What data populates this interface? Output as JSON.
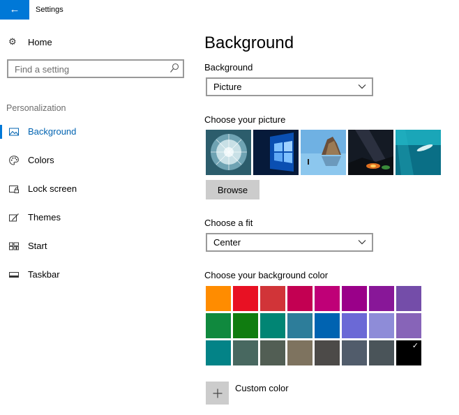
{
  "titlebar": {
    "back_icon": "←",
    "title": "Settings"
  },
  "sidebar": {
    "home_icon": "⚙",
    "home_label": "Home",
    "search_placeholder": "Find a setting",
    "section": "Personalization",
    "items": [
      {
        "label": "Background",
        "icon": "picture-icon",
        "active": true
      },
      {
        "label": "Colors",
        "icon": "palette-icon"
      },
      {
        "label": "Lock screen",
        "icon": "lock-screen-icon"
      },
      {
        "label": "Themes",
        "icon": "themes-icon"
      },
      {
        "label": "Start",
        "icon": "start-icon"
      },
      {
        "label": "Taskbar",
        "icon": "taskbar-icon"
      }
    ]
  },
  "main": {
    "title": "Background",
    "background_label": "Background",
    "background_value": "Picture",
    "picture_label": "Choose your picture",
    "browse_label": "Browse",
    "fit_label": "Choose a fit",
    "fit_value": "Center",
    "color_label": "Choose your background color",
    "custom_color_label": "Custom color",
    "selected_color": "#000000",
    "colors": [
      "#ff8c00",
      "#e81123",
      "#d13438",
      "#c30052",
      "#bf0077",
      "#9a0089",
      "#881798",
      "#744da9",
      "#10893e",
      "#107c10",
      "#018574",
      "#2d7d9a",
      "#0063b1",
      "#6b69d6",
      "#8e8cd8",
      "#8764b8",
      "#038387",
      "#486860",
      "#525e54",
      "#7e735f",
      "#4c4a48",
      "#515c6b",
      "#4a5459",
      "#000000"
    ]
  },
  "accent": "#0078d7"
}
